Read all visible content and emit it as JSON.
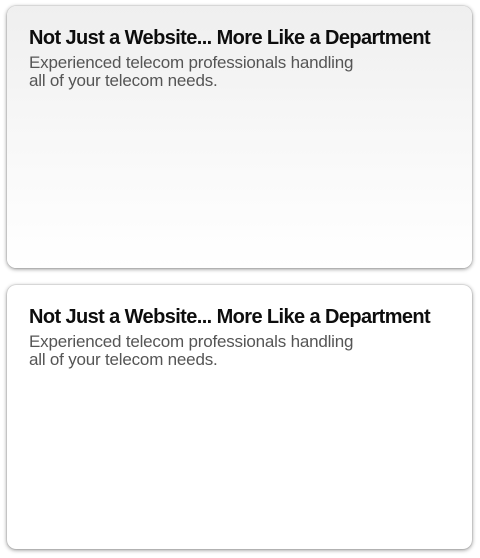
{
  "cards": [
    {
      "title": "Not Just a Website... More Like a Department",
      "description_line1": "Experienced telecom professionals handling",
      "description_line2": "all of your telecom needs."
    },
    {
      "title": "Not Just a Website... More Like a Department",
      "description_line1": "Experienced telecom professionals handling",
      "description_line2": "all of your telecom needs."
    }
  ]
}
